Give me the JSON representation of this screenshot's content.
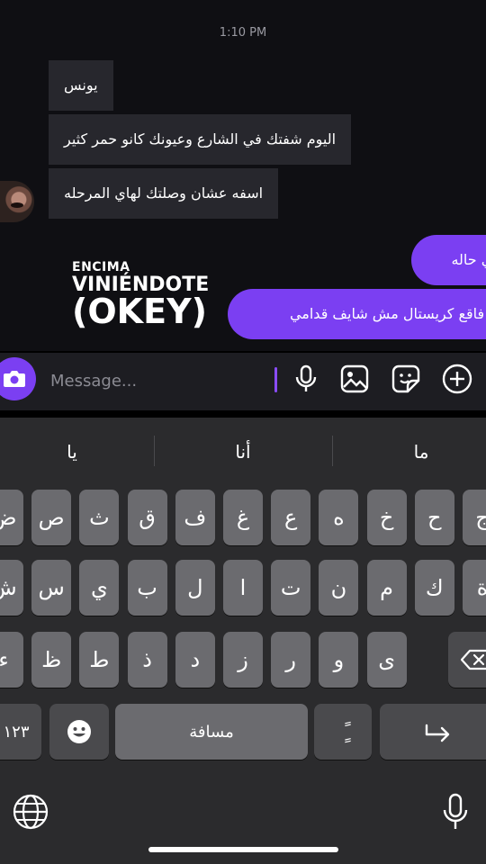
{
  "chat": {
    "timestamp": "1:10 PM",
    "incoming": [
      "يونس",
      "اليوم شفتك في الشارع وعيونك كانو حمر كثير",
      "اسفه عشان وصلتك لهاي المرحله"
    ],
    "outgoing": [
      "اني حاله",
      "انا فاقع كريستال مش شايف قدامي"
    ],
    "sticker": {
      "line1": "ENCIMA",
      "line2": "VINIÉNDOTE",
      "line3": "(OKEY)"
    }
  },
  "composer": {
    "placeholder": "Message...",
    "icons": [
      "camera-icon",
      "microphone-icon",
      "image-icon",
      "sticker-icon",
      "add-icon"
    ]
  },
  "keyboard": {
    "suggestions": [
      "يا",
      "أنا",
      "ما"
    ],
    "rows": [
      [
        "ض",
        "ص",
        "ث",
        "ق",
        "ف",
        "غ",
        "ع",
        "ه",
        "خ",
        "ح",
        "ج"
      ],
      [
        "ش",
        "س",
        "ي",
        "ب",
        "ل",
        "ا",
        "ت",
        "ن",
        "م",
        "ك",
        "ة"
      ],
      [
        "ء",
        "ظ",
        "ط",
        "ذ",
        "د",
        "ز",
        "ر",
        "و",
        "ى"
      ]
    ],
    "numbers_label": "١٢٣",
    "space_label": "مسافة",
    "diacritic_label": "ًٍ",
    "colors": {
      "accent": "#7b3ff2",
      "key": "#6b6b6f",
      "key_dark": "#4a4a4d",
      "background": "#2b2b2d"
    }
  }
}
